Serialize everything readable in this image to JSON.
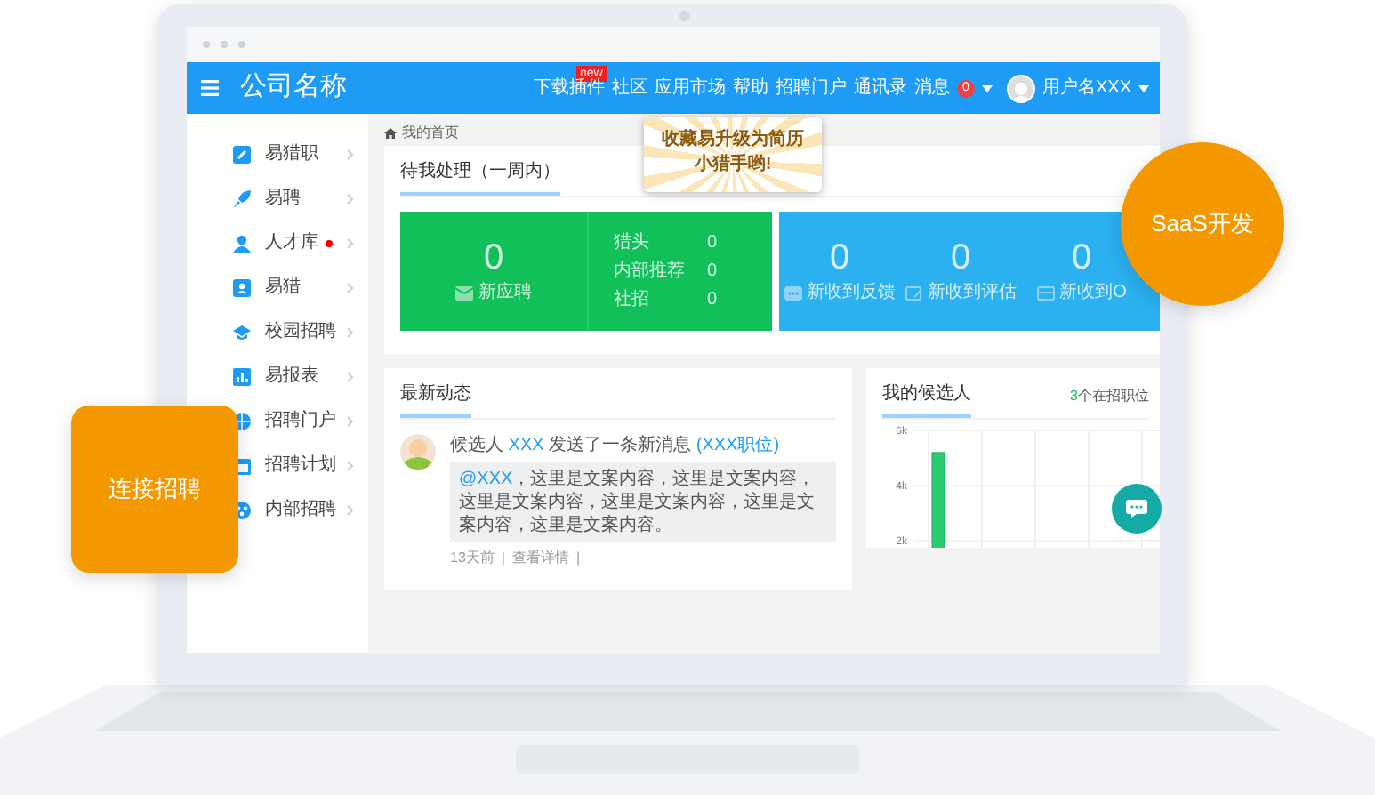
{
  "header": {
    "title": "公司名称",
    "nav": [
      {
        "label": "下载插件",
        "badge": "new"
      },
      {
        "label": "社区"
      },
      {
        "label": "应用市场"
      },
      {
        "label": "帮助"
      },
      {
        "label": "招聘门户"
      },
      {
        "label": "通讯录"
      },
      {
        "label": "消息",
        "count": "0"
      }
    ],
    "user": {
      "name": "用户名XXX"
    }
  },
  "tooltip": {
    "lines": [
      "收藏易升级为简历",
      "小猎手哟!"
    ]
  },
  "sidebar": {
    "items": [
      {
        "label": "易猎职",
        "unread": false
      },
      {
        "label": "易聘",
        "unread": false
      },
      {
        "label": "人才库",
        "unread": true
      },
      {
        "label": "易猎",
        "unread": false
      },
      {
        "label": "校园招聘",
        "unread": false
      },
      {
        "label": "易报表",
        "unread": false
      },
      {
        "label": "招聘门户",
        "unread": false
      },
      {
        "label": "招聘计划",
        "unread": false
      },
      {
        "label": "内部招聘",
        "unread": false
      }
    ]
  },
  "breadcrumb": "我的首页",
  "pending": {
    "title": "待我处理（一周内）",
    "primary": {
      "value": "0",
      "label": "新应聘"
    },
    "breakdown": [
      {
        "label": "猎头",
        "value": "0"
      },
      {
        "label": "内部推荐",
        "value": "0"
      },
      {
        "label": "社招",
        "value": "0"
      }
    ],
    "others": [
      {
        "value": "0",
        "label": "新收到反馈"
      },
      {
        "value": "0",
        "label": "新收到评估"
      },
      {
        "value": "0",
        "label": "新收到O"
      }
    ]
  },
  "feed": {
    "title": "最新动态",
    "items": [
      {
        "role": "候选人",
        "actor": "XXX",
        "action": "发送了一条新消息",
        "position": "(XXX职位)",
        "mention": "@XXX",
        "message": "，这里是文案内容，这里是文案内容，这里是文案内容，这里是文案内容，这里是文案内容，这里是文案内容。",
        "time": "13天前",
        "separators": [
          "|",
          "|"
        ],
        "link": "查看详情"
      }
    ]
  },
  "candidates": {
    "title": "我的候选人",
    "count": "3",
    "count_label": "个在招职位",
    "chart_data": {
      "type": "bar",
      "values": [
        5200
      ],
      "ylim": [
        1500,
        6000
      ],
      "yticks": [
        {
          "value": 2000,
          "label": "2k"
        },
        {
          "value": 4000,
          "label": "4k"
        },
        {
          "value": 6000,
          "label": "6k"
        }
      ]
    }
  },
  "promos": [
    {
      "kind": "circle",
      "label": "SaaS开发"
    },
    {
      "kind": "square",
      "label": "连接招聘"
    }
  ]
}
